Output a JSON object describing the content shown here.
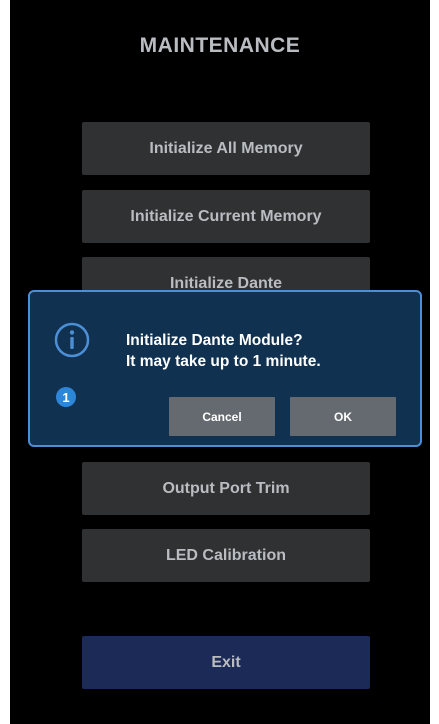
{
  "screen": {
    "title": "MAINTENANCE"
  },
  "menu": {
    "items": [
      {
        "label": "Initialize All Memory"
      },
      {
        "label": "Initialize Current Memory"
      },
      {
        "label": "Initialize Dante"
      },
      {
        "label": "Output Port Trim"
      },
      {
        "label": "LED Calibration"
      }
    ],
    "exit_label": "Exit"
  },
  "dialog": {
    "icon": "info-icon",
    "message_line1": "Initialize Dante Module?",
    "message_line2": "It may take up to 1 minute.",
    "badge": "1",
    "cancel_label": "Cancel",
    "ok_label": "OK"
  },
  "colors": {
    "background": "#000000",
    "button": "#2f3133",
    "exit_button": "#1b2a57",
    "dialog_background": "#103150",
    "dialog_border": "#4c8fd6",
    "dialog_button": "#656a70",
    "badge": "#2e86d8"
  }
}
